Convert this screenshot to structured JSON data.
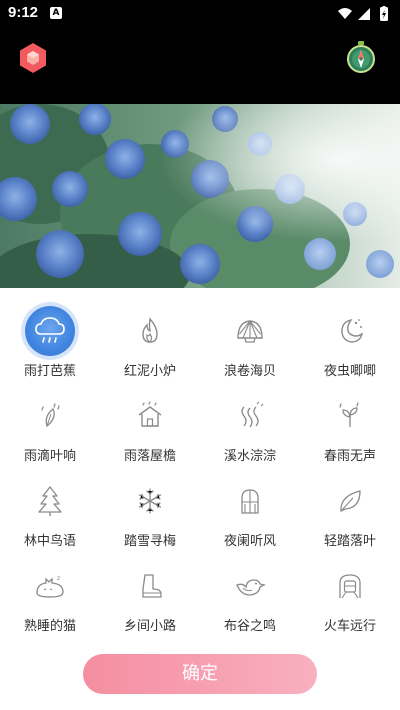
{
  "status_bar": {
    "time": "9:12",
    "notification_badge": "A"
  },
  "colors": {
    "accent_pink": "#f48ea0",
    "active_blue": "#3f84e0",
    "icon_gray": "#8a8a8a",
    "header_bg": "#000000"
  },
  "header": {
    "logo_icon": "red-hexagon-icon",
    "action_icon": "compass-icon"
  },
  "hero": {
    "image": "blue hydrangea garden"
  },
  "sounds": [
    {
      "label": "雨打芭蕉",
      "icon": "cloud-rain-icon",
      "selected": true
    },
    {
      "label": "红泥小炉",
      "icon": "flame-icon",
      "selected": false
    },
    {
      "label": "浪卷海贝",
      "icon": "seashell-icon",
      "selected": false
    },
    {
      "label": "夜虫唧唧",
      "icon": "moon-stars-icon",
      "selected": false
    },
    {
      "label": "雨滴叶响",
      "icon": "leaf-rain-icon",
      "selected": false
    },
    {
      "label": "雨落屋檐",
      "icon": "house-rain-icon",
      "selected": false
    },
    {
      "label": "溪水淙淙",
      "icon": "stream-icon",
      "selected": false
    },
    {
      "label": "春雨无声",
      "icon": "sprout-rain-icon",
      "selected": false
    },
    {
      "label": "林中鸟语",
      "icon": "pine-tree-icon",
      "selected": false
    },
    {
      "label": "踏雪寻梅",
      "icon": "snowflake-icon",
      "selected": false
    },
    {
      "label": "夜阑听风",
      "icon": "window-icon",
      "selected": false
    },
    {
      "label": "轻踏落叶",
      "icon": "leaf-icon",
      "selected": false
    },
    {
      "label": "熟睡的猫",
      "icon": "sleeping-cat-icon",
      "selected": false
    },
    {
      "label": "乡间小路",
      "icon": "boot-icon",
      "selected": false
    },
    {
      "label": "布谷之鸣",
      "icon": "bird-icon",
      "selected": false
    },
    {
      "label": "火车远行",
      "icon": "train-icon",
      "selected": false
    }
  ],
  "confirm_label": "确定"
}
